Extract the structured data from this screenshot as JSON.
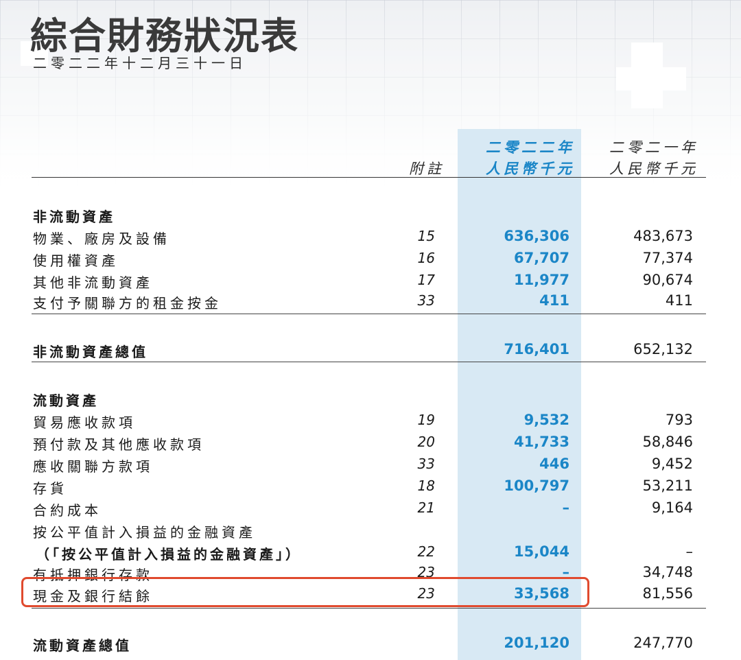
{
  "header": {
    "title": "綜合財務狀況表",
    "date": "二零二二年十二月三十一日"
  },
  "columns": {
    "note": "附註",
    "current_year": "二零二二年",
    "current_unit": "人民幣千元",
    "prior_year": "二零二一年",
    "prior_unit": "人民幣千元"
  },
  "non_current": {
    "heading": "非流動資產",
    "rows": [
      {
        "label": "物業、廠房及設備",
        "note": "15",
        "cur": "636,306",
        "prev": "483,673"
      },
      {
        "label": "使用權資產",
        "note": "16",
        "cur": "67,707",
        "prev": "77,374"
      },
      {
        "label": "其他非流動資產",
        "note": "17",
        "cur": "11,977",
        "prev": "90,674"
      },
      {
        "label": "支付予關聯方的租金按金",
        "note": "33",
        "cur": "411",
        "prev": "411"
      }
    ],
    "total": {
      "label": "非流動資產總值",
      "cur": "716,401",
      "prev": "652,132"
    }
  },
  "current": {
    "heading": "流動資產",
    "rows": [
      {
        "label": "貿易應收款項",
        "note": "19",
        "cur": "9,532",
        "prev": "793"
      },
      {
        "label": "預付款及其他應收款項",
        "note": "20",
        "cur": "41,733",
        "prev": "58,846"
      },
      {
        "label": "應收關聯方款項",
        "note": "33",
        "cur": "446",
        "prev": "9,452"
      },
      {
        "label": "存貨",
        "note": "18",
        "cur": "100,797",
        "prev": "53,211"
      },
      {
        "label": "合約成本",
        "note": "21",
        "cur": "–",
        "prev": "9,164"
      },
      {
        "label": "按公平值計入損益的金融資產",
        "note": "",
        "cur": "",
        "prev": ""
      },
      {
        "label": "（「按公平值計入損益的金融資產」）",
        "note": "22",
        "cur": "15,044",
        "prev": "–"
      },
      {
        "label": "有抵押銀行存款",
        "note": "23",
        "cur": "–",
        "prev": "34,748"
      },
      {
        "label": "現金及銀行結餘",
        "note": "23",
        "cur": "33,568",
        "prev": "81,556"
      }
    ],
    "total": {
      "label": "流動資產總值",
      "cur": "201,120",
      "prev": "247,770"
    }
  },
  "colors": {
    "accent": "#1b86c7",
    "highlight_column": "#d8e9f4",
    "annotation_box": "#e04a2e"
  }
}
